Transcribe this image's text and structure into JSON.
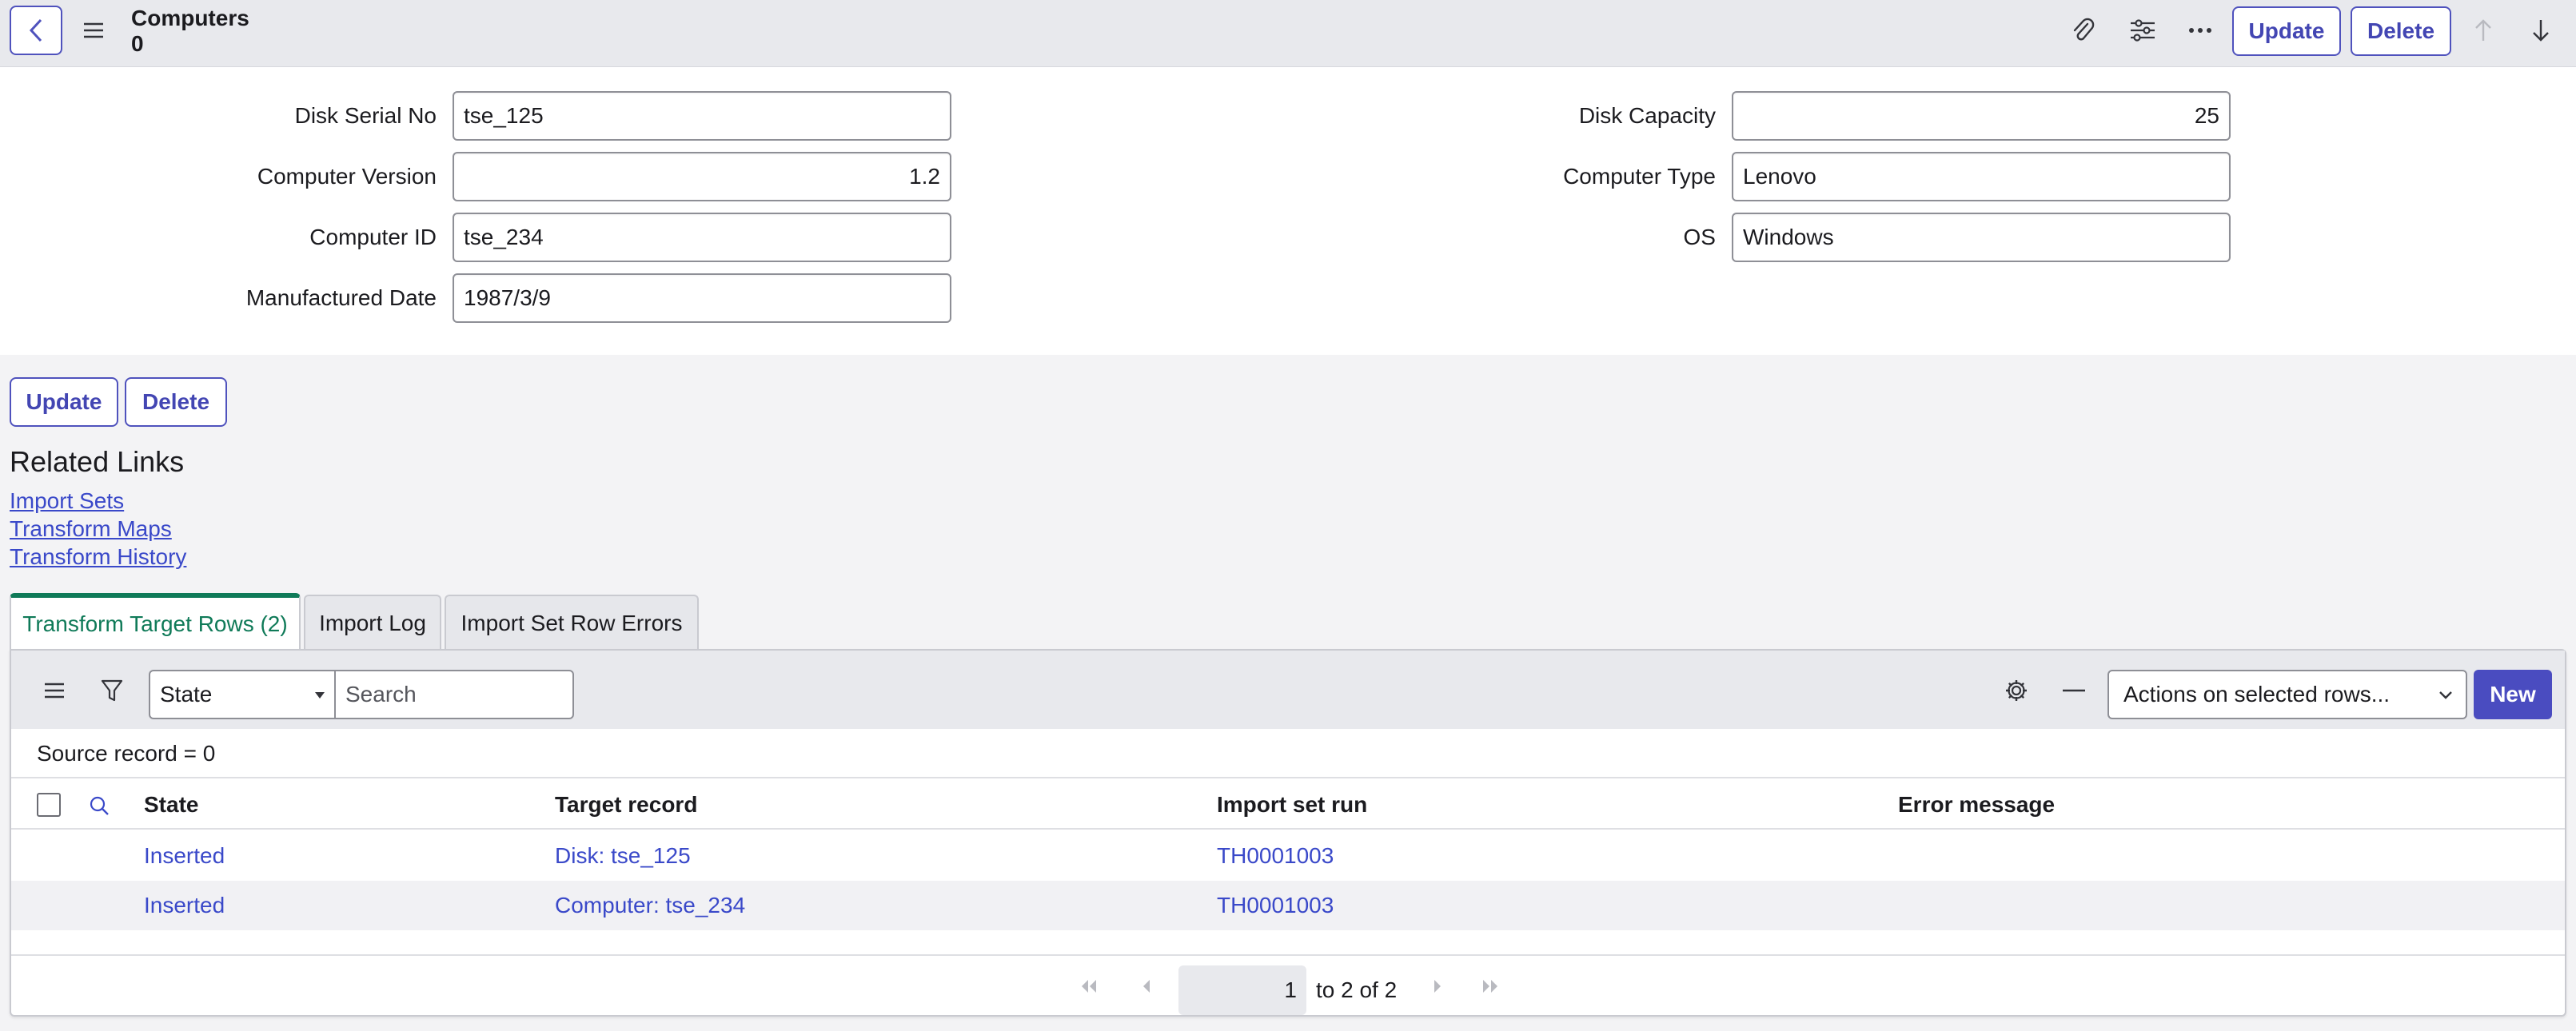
{
  "header": {
    "title": "Computers",
    "subtitle": "0",
    "update_label": "Update",
    "delete_label": "Delete"
  },
  "form": {
    "left": [
      {
        "label": "Disk Serial No",
        "value": "tse_125"
      },
      {
        "label": "Computer Version",
        "value": "1.2"
      },
      {
        "label": "Computer ID",
        "value": "tse_234"
      },
      {
        "label": "Manufactured Date",
        "value": "1987/3/9"
      }
    ],
    "right": [
      {
        "label": "Disk Capacity",
        "value": "25"
      },
      {
        "label": "Computer Type",
        "value": "Lenovo"
      },
      {
        "label": "OS",
        "value": "Windows"
      }
    ]
  },
  "bottom_buttons": {
    "update_label": "Update",
    "delete_label": "Delete"
  },
  "related_links": {
    "title": "Related Links",
    "links": [
      "Import Sets",
      "Transform Maps",
      "Transform History"
    ]
  },
  "tabs": [
    {
      "label": "Transform Target Rows (2)",
      "active": true
    },
    {
      "label": "Import Log",
      "active": false
    },
    {
      "label": "Import Set Row Errors",
      "active": false
    }
  ],
  "list": {
    "filter_field": "State",
    "search_placeholder": "Search",
    "actions_label": "Actions on selected rows...",
    "new_label": "New",
    "source_line": "Source record = 0",
    "columns": [
      "State",
      "Target record",
      "Import set run",
      "Error message"
    ],
    "rows": [
      {
        "state": "Inserted",
        "target": "Disk: tse_125",
        "run": "TH0001003",
        "error": ""
      },
      {
        "state": "Inserted",
        "target": "Computer: tse_234",
        "run": "TH0001003",
        "error": ""
      }
    ],
    "pager": {
      "page": "1",
      "range_text": "to 2 of 2"
    }
  },
  "colors": {
    "accent": "#4f52bd",
    "tab_active": "#0f7a58",
    "link": "#3a49c9"
  }
}
